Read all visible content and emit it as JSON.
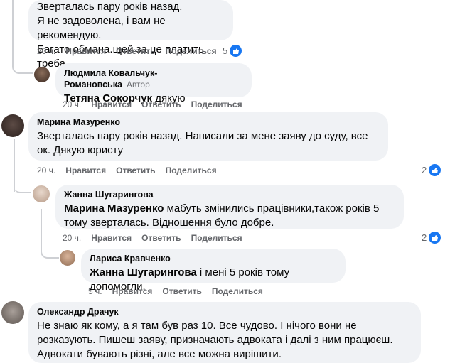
{
  "c1": {
    "lines": [
      "Зверталась пару років назад.",
      "Я не задоволена, і вам не рекомендую.",
      "Багато обмана.щей за це платить треба."
    ],
    "time": "20 ч.",
    "like": "Нравится",
    "reply": "Ответить",
    "share": "Поделиться",
    "reactions": "5"
  },
  "c2": {
    "name": "Людмила Ковальчук-Романовська",
    "badge": "Автор",
    "tag": "Тетяна Сокорчук",
    "text": " дякую",
    "time": "20 ч.",
    "like": "Нравится",
    "reply": "Ответить",
    "share": "Поделиться"
  },
  "c3": {
    "name": "Марина Мазуренко",
    "text": "Зверталась пару років назад. Написали за мене заяву до суду, все ок. Дякую юристу",
    "time": "20 ч.",
    "like": "Нравится",
    "reply": "Ответить",
    "share": "Поделиться",
    "reactions": "2"
  },
  "c4": {
    "name": "Жанна Шугарингова",
    "tag": "Марина Мазуренко",
    "text": " мабуть змінились працівники,також років 5 тому зверталась. Відношення було добре.",
    "time": "20 ч.",
    "like": "Нравится",
    "reply": "Ответить",
    "share": "Поделиться",
    "reactions": "2"
  },
  "c5": {
    "name": "Лариса Кравченко",
    "tag": "Жанна Шугарингова",
    "text": " і мені 5 років тому допомогли.",
    "time": "5 ч.",
    "like": "Нравится",
    "reply": "Ответить",
    "share": "Поделиться"
  },
  "c6": {
    "name": "Олександр Драчук",
    "text": "Не знаю як кому, а я там був раз 10. Все чудово. І нічого вони не розказують. Пишеш заяву, призначають адвоката і далі з ним працюєш. Адвокати бувають різні, але все можна вирішити."
  },
  "colors": {
    "bubble": "#f0f2f5",
    "meta": "#65676b",
    "like_blue": "#1877f2",
    "thread": "#ced0d4"
  },
  "icons": {
    "reaction": "like-icon"
  }
}
